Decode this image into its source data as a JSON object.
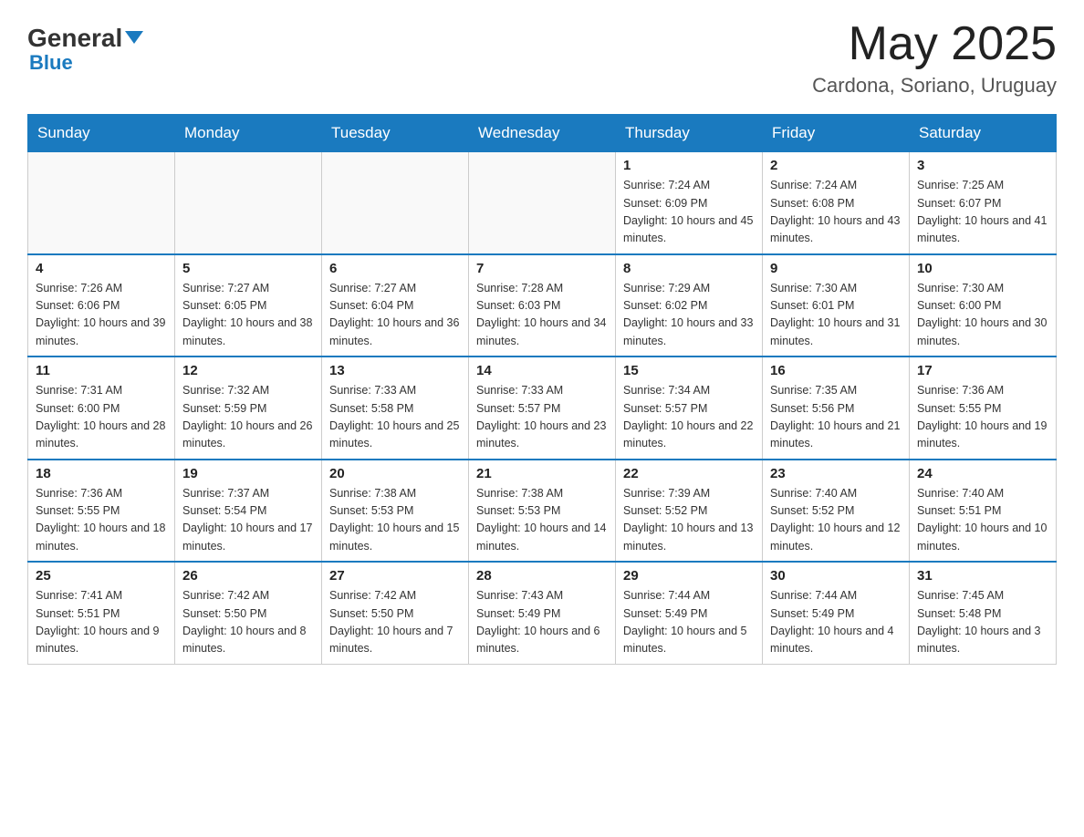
{
  "header": {
    "logo_general": "General",
    "logo_blue": "Blue",
    "month_year": "May 2025",
    "location": "Cardona, Soriano, Uruguay"
  },
  "days_of_week": [
    "Sunday",
    "Monday",
    "Tuesday",
    "Wednesday",
    "Thursday",
    "Friday",
    "Saturday"
  ],
  "weeks": [
    [
      {
        "day": "",
        "info": ""
      },
      {
        "day": "",
        "info": ""
      },
      {
        "day": "",
        "info": ""
      },
      {
        "day": "",
        "info": ""
      },
      {
        "day": "1",
        "info": "Sunrise: 7:24 AM\nSunset: 6:09 PM\nDaylight: 10 hours and 45 minutes."
      },
      {
        "day": "2",
        "info": "Sunrise: 7:24 AM\nSunset: 6:08 PM\nDaylight: 10 hours and 43 minutes."
      },
      {
        "day": "3",
        "info": "Sunrise: 7:25 AM\nSunset: 6:07 PM\nDaylight: 10 hours and 41 minutes."
      }
    ],
    [
      {
        "day": "4",
        "info": "Sunrise: 7:26 AM\nSunset: 6:06 PM\nDaylight: 10 hours and 39 minutes."
      },
      {
        "day": "5",
        "info": "Sunrise: 7:27 AM\nSunset: 6:05 PM\nDaylight: 10 hours and 38 minutes."
      },
      {
        "day": "6",
        "info": "Sunrise: 7:27 AM\nSunset: 6:04 PM\nDaylight: 10 hours and 36 minutes."
      },
      {
        "day": "7",
        "info": "Sunrise: 7:28 AM\nSunset: 6:03 PM\nDaylight: 10 hours and 34 minutes."
      },
      {
        "day": "8",
        "info": "Sunrise: 7:29 AM\nSunset: 6:02 PM\nDaylight: 10 hours and 33 minutes."
      },
      {
        "day": "9",
        "info": "Sunrise: 7:30 AM\nSunset: 6:01 PM\nDaylight: 10 hours and 31 minutes."
      },
      {
        "day": "10",
        "info": "Sunrise: 7:30 AM\nSunset: 6:00 PM\nDaylight: 10 hours and 30 minutes."
      }
    ],
    [
      {
        "day": "11",
        "info": "Sunrise: 7:31 AM\nSunset: 6:00 PM\nDaylight: 10 hours and 28 minutes."
      },
      {
        "day": "12",
        "info": "Sunrise: 7:32 AM\nSunset: 5:59 PM\nDaylight: 10 hours and 26 minutes."
      },
      {
        "day": "13",
        "info": "Sunrise: 7:33 AM\nSunset: 5:58 PM\nDaylight: 10 hours and 25 minutes."
      },
      {
        "day": "14",
        "info": "Sunrise: 7:33 AM\nSunset: 5:57 PM\nDaylight: 10 hours and 23 minutes."
      },
      {
        "day": "15",
        "info": "Sunrise: 7:34 AM\nSunset: 5:57 PM\nDaylight: 10 hours and 22 minutes."
      },
      {
        "day": "16",
        "info": "Sunrise: 7:35 AM\nSunset: 5:56 PM\nDaylight: 10 hours and 21 minutes."
      },
      {
        "day": "17",
        "info": "Sunrise: 7:36 AM\nSunset: 5:55 PM\nDaylight: 10 hours and 19 minutes."
      }
    ],
    [
      {
        "day": "18",
        "info": "Sunrise: 7:36 AM\nSunset: 5:55 PM\nDaylight: 10 hours and 18 minutes."
      },
      {
        "day": "19",
        "info": "Sunrise: 7:37 AM\nSunset: 5:54 PM\nDaylight: 10 hours and 17 minutes."
      },
      {
        "day": "20",
        "info": "Sunrise: 7:38 AM\nSunset: 5:53 PM\nDaylight: 10 hours and 15 minutes."
      },
      {
        "day": "21",
        "info": "Sunrise: 7:38 AM\nSunset: 5:53 PM\nDaylight: 10 hours and 14 minutes."
      },
      {
        "day": "22",
        "info": "Sunrise: 7:39 AM\nSunset: 5:52 PM\nDaylight: 10 hours and 13 minutes."
      },
      {
        "day": "23",
        "info": "Sunrise: 7:40 AM\nSunset: 5:52 PM\nDaylight: 10 hours and 12 minutes."
      },
      {
        "day": "24",
        "info": "Sunrise: 7:40 AM\nSunset: 5:51 PM\nDaylight: 10 hours and 10 minutes."
      }
    ],
    [
      {
        "day": "25",
        "info": "Sunrise: 7:41 AM\nSunset: 5:51 PM\nDaylight: 10 hours and 9 minutes."
      },
      {
        "day": "26",
        "info": "Sunrise: 7:42 AM\nSunset: 5:50 PM\nDaylight: 10 hours and 8 minutes."
      },
      {
        "day": "27",
        "info": "Sunrise: 7:42 AM\nSunset: 5:50 PM\nDaylight: 10 hours and 7 minutes."
      },
      {
        "day": "28",
        "info": "Sunrise: 7:43 AM\nSunset: 5:49 PM\nDaylight: 10 hours and 6 minutes."
      },
      {
        "day": "29",
        "info": "Sunrise: 7:44 AM\nSunset: 5:49 PM\nDaylight: 10 hours and 5 minutes."
      },
      {
        "day": "30",
        "info": "Sunrise: 7:44 AM\nSunset: 5:49 PM\nDaylight: 10 hours and 4 minutes."
      },
      {
        "day": "31",
        "info": "Sunrise: 7:45 AM\nSunset: 5:48 PM\nDaylight: 10 hours and 3 minutes."
      }
    ]
  ]
}
